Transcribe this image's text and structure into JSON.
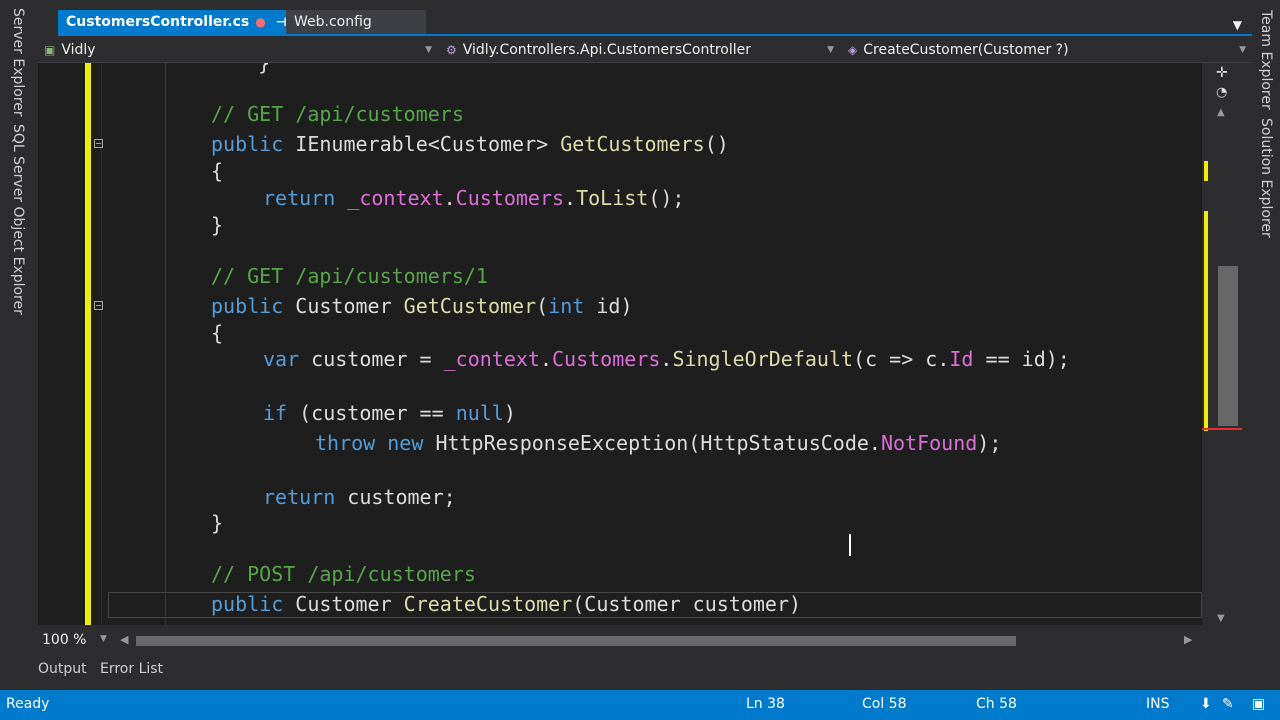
{
  "left_rail": {
    "tabs": [
      "Server Explorer",
      "SQL Server Object Explorer"
    ]
  },
  "right_rail": {
    "tabs": [
      "Team Explorer",
      "Solution Explorer"
    ]
  },
  "tabs": {
    "active": {
      "label": "CustomersController.cs",
      "modified": "●",
      "pin": "⊣",
      "close": "✕"
    },
    "inactive": {
      "label": "Web.config"
    },
    "overflow_icon": "chevron-down-icon"
  },
  "navbar": {
    "project": "Vidly",
    "class": "Vidly.Controllers.Api.CustomersController",
    "member": "CreateCustomer(Customer ?)"
  },
  "code": [
    {
      "text": "    }"
    },
    {
      "comment": "// GET /api/customers"
    },
    {
      "sig": {
        "mod": "public",
        "type": "IEnumerable<Customer>",
        "name": "GetCustomers",
        "params": "()"
      }
    },
    {
      "text": "{"
    },
    {
      "ret1": {
        "kw": "return",
        "obj": "_context",
        "fld": "Customers",
        "m": "ToList",
        "end": "();"
      }
    },
    {
      "text": "}"
    },
    {
      "comment2": "// GET /api/customers/1"
    },
    {
      "sig2": {
        "mod": "public",
        "type": "Customer",
        "name": "GetCustomer",
        "p1": "int",
        "p2": "id"
      }
    },
    {
      "text2": "{"
    },
    {
      "var": {
        "kw": "var",
        "lhs": "customer =",
        "obj": "_context",
        "fld": "Customers",
        "m": "SingleOrDefault",
        "args1": "(c => c.",
        "prop": "Id",
        "args2": " == id);"
      }
    },
    {
      "if": {
        "kw": "if",
        "cond1": "(customer == ",
        "nul": "null",
        "cond2": ")"
      }
    },
    {
      "throw": {
        "kw1": "throw",
        "kw2": "new",
        "ex": "HttpResponseException(HttpStatusCode.",
        "fld": "NotFound",
        "end": ");"
      }
    },
    {
      "ret2": {
        "kw": "return",
        "rest": "customer;"
      }
    },
    {
      "text3": "}"
    },
    {
      "comment3": "// POST /api/customers"
    },
    {
      "sig3": {
        "mod": "public",
        "type": "Customer",
        "name": "CreateCustomer",
        "params": "(Customer customer)"
      }
    }
  ],
  "zoom": "100 %",
  "bottom_tabs": [
    "Output",
    "Error List"
  ],
  "status": {
    "ready": "Ready",
    "ln": "Ln 38",
    "col": "Col 58",
    "ch": "Ch 58",
    "ins": "INS"
  }
}
